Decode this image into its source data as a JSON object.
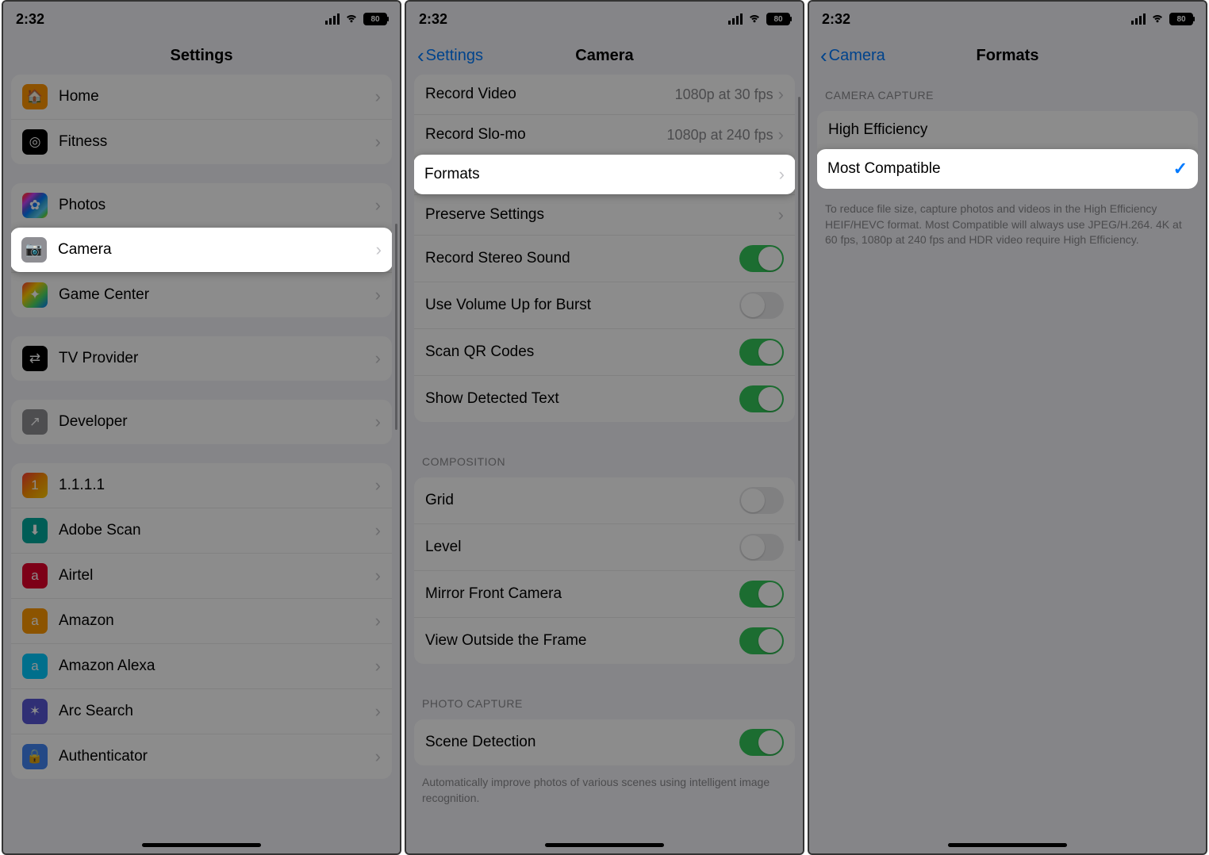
{
  "status": {
    "time": "2:32",
    "battery": "80"
  },
  "panel1": {
    "title": "Settings",
    "groups": [
      {
        "items": [
          {
            "icon": "ic-home",
            "label": "Home",
            "glyph": "🏠"
          },
          {
            "icon": "ic-fitness",
            "label": "Fitness",
            "glyph": "◎"
          }
        ]
      },
      {
        "items": [
          {
            "icon": "ic-photos",
            "label": "Photos",
            "glyph": "✿"
          },
          {
            "icon": "ic-camera",
            "label": "Camera",
            "glyph": "📷",
            "highlight": true
          },
          {
            "icon": "ic-gc",
            "label": "Game Center",
            "glyph": "✦"
          }
        ]
      },
      {
        "items": [
          {
            "icon": "ic-tv",
            "label": "TV Provider",
            "glyph": "⇄"
          }
        ]
      },
      {
        "items": [
          {
            "icon": "ic-dev",
            "label": "Developer",
            "glyph": "↗"
          }
        ]
      },
      {
        "items": [
          {
            "icon": "ic-1111",
            "label": "1.1.1.1",
            "glyph": "1"
          },
          {
            "icon": "ic-adobe",
            "label": "Adobe Scan",
            "glyph": "⬇"
          },
          {
            "icon": "ic-airtel",
            "label": "Airtel",
            "glyph": "a"
          },
          {
            "icon": "ic-amazon",
            "label": "Amazon",
            "glyph": "a"
          },
          {
            "icon": "ic-alexa",
            "label": "Amazon Alexa",
            "glyph": "a"
          },
          {
            "icon": "ic-arc",
            "label": "Arc Search",
            "glyph": "✶"
          },
          {
            "icon": "ic-auth",
            "label": "Authenticator",
            "glyph": "🔒"
          }
        ]
      }
    ]
  },
  "panel2": {
    "back": "Settings",
    "title": "Camera",
    "rows": [
      {
        "label": "Record Video",
        "detail": "1080p at 30 fps",
        "type": "link"
      },
      {
        "label": "Record Slo-mo",
        "detail": "1080p at 240 fps",
        "type": "link"
      },
      {
        "label": "Formats",
        "type": "link",
        "highlight": true
      },
      {
        "label": "Preserve Settings",
        "type": "link"
      },
      {
        "label": "Record Stereo Sound",
        "type": "toggle",
        "on": true
      },
      {
        "label": "Use Volume Up for Burst",
        "type": "toggle",
        "on": false
      },
      {
        "label": "Scan QR Codes",
        "type": "toggle",
        "on": true
      },
      {
        "label": "Show Detected Text",
        "type": "toggle",
        "on": true
      }
    ],
    "section2": {
      "header": "COMPOSITION",
      "rows": [
        {
          "label": "Grid",
          "type": "toggle",
          "on": false
        },
        {
          "label": "Level",
          "type": "toggle",
          "on": false
        },
        {
          "label": "Mirror Front Camera",
          "type": "toggle",
          "on": true
        },
        {
          "label": "View Outside the Frame",
          "type": "toggle",
          "on": true
        }
      ]
    },
    "section3": {
      "header": "PHOTO CAPTURE",
      "rows": [
        {
          "label": "Scene Detection",
          "type": "toggle",
          "on": true
        }
      ],
      "footer": "Automatically improve photos of various scenes using intelligent image recognition."
    }
  },
  "panel3": {
    "back": "Camera",
    "title": "Formats",
    "header": "CAMERA CAPTURE",
    "rows": [
      {
        "label": "High Efficiency",
        "checked": false
      },
      {
        "label": "Most Compatible",
        "checked": true,
        "highlight": true
      }
    ],
    "footer": "To reduce file size, capture photos and videos in the High Efficiency HEIF/HEVC format. Most Compatible will always use JPEG/H.264. 4K at 60 fps, 1080p at 240 fps and HDR video require High Efficiency."
  }
}
